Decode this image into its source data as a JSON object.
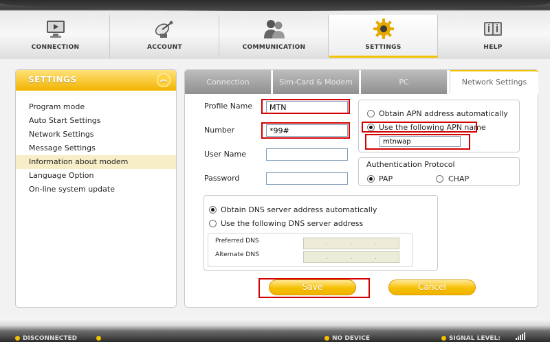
{
  "nav": {
    "tabs": [
      {
        "label": "CONNECTION",
        "icon": "monitor-icon"
      },
      {
        "label": "ACCOUNT",
        "icon": "satellite-icon"
      },
      {
        "label": "COMMUNICATION",
        "icon": "people-icon"
      },
      {
        "label": "SETTINGS",
        "icon": "gear-icon"
      },
      {
        "label": "HELP",
        "icon": "help-book-icon"
      }
    ],
    "active": "SETTINGS"
  },
  "sidebar": {
    "title": "SETTINGS",
    "items": [
      {
        "label": "Program mode"
      },
      {
        "label": "Auto Start Settings"
      },
      {
        "label": "Network Settings"
      },
      {
        "label": "Message Settings"
      },
      {
        "label": "Information about modem"
      },
      {
        "label": "Language Option"
      },
      {
        "label": "On-line system update"
      }
    ],
    "selected": "Information about modem"
  },
  "subtabs": {
    "items": [
      "Connection",
      "Sim-Card & Modem",
      "PC",
      "Network Settings"
    ],
    "active": "Network Settings"
  },
  "form": {
    "profile_name_label": "Profile Name",
    "profile_name_value": "MTN",
    "number_label": "Number",
    "number_value": "*99#",
    "user_name_label": "User Name",
    "user_name_value": "",
    "password_label": "Password",
    "password_value": ""
  },
  "apn": {
    "auto_label": "Obtain APN address automatically",
    "manual_label": "Use the following APN name",
    "selected": "manual",
    "apn_value": "mtnwap"
  },
  "auth": {
    "title": "Authentication Protocol",
    "pap_label": "PAP",
    "chap_label": "CHAP",
    "selected": "PAP"
  },
  "dns": {
    "auto_label": "Obtain DNS server address automatically",
    "manual_label": "Use the following DNS server address",
    "selected": "auto",
    "preferred_label": "Preferred DNS",
    "alternate_label": "Alternate DNS",
    "separator": "."
  },
  "buttons": {
    "save": "Save",
    "cancel": "Cancel"
  },
  "status": {
    "connection": "DISCONNECTED",
    "device": "NO DEVICE",
    "signal_label": "SIGNAL LEVEL:"
  },
  "colors": {
    "accent": "#f3c000",
    "annotation_red": "#d20000"
  }
}
